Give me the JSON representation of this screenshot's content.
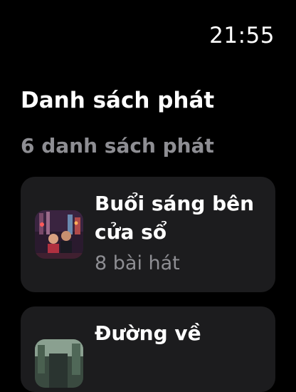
{
  "status": {
    "time": "21:55"
  },
  "header": {
    "title": "Danh sách phát",
    "count_label": "6 danh sách phát"
  },
  "playlists": [
    {
      "title": "Buổi sáng bên cửa sổ",
      "subtitle": "8 bài hát",
      "artwork": "city-night-couple-artwork"
    },
    {
      "title": "Đường về",
      "artwork": "street-artwork"
    }
  ],
  "colors": {
    "background": "#000000",
    "card": "#1c1c1e",
    "secondary_text": "#8e8e93"
  }
}
